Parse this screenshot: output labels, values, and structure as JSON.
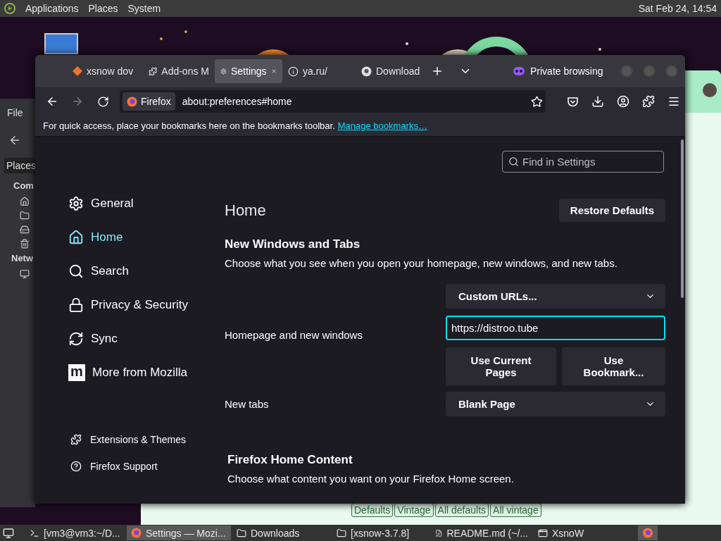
{
  "top_panel": {
    "menus": [
      "Applications",
      "Places",
      "System"
    ],
    "clock": "Sat Feb 24, 14:54"
  },
  "file_manager": {
    "menu": "File",
    "places_button": "Places",
    "sections": [
      "Com",
      "Netw"
    ]
  },
  "xsnow_window": {
    "buttons": [
      "Defaults",
      "Vintage",
      "All defaults",
      "All vintage"
    ]
  },
  "browser": {
    "tabs": [
      {
        "label": "xsnow dov",
        "kind": "xsnow",
        "selected": false
      },
      {
        "label": "Add-ons M",
        "kind": "addons",
        "selected": false
      },
      {
        "label": "Settings",
        "kind": "settings",
        "selected": true
      },
      {
        "label": "ya.ru/",
        "kind": "info",
        "selected": false
      },
      {
        "label": "Download",
        "kind": "download",
        "selected": false
      }
    ],
    "private_label": "Private browsing",
    "identity": "Firefox",
    "address": "about:preferences#home",
    "bookmarks_hint": "For quick access, place your bookmarks here on the bookmarks toolbar.",
    "bookmarks_link": "Manage bookmarks…"
  },
  "settings": {
    "search_placeholder": "Find in Settings",
    "nav": [
      {
        "label": "General",
        "kind": "general",
        "selected": false
      },
      {
        "label": "Home",
        "kind": "home",
        "selected": true
      },
      {
        "label": "Search",
        "kind": "search",
        "selected": false
      },
      {
        "label": "Privacy & Security",
        "kind": "privacy",
        "selected": false
      },
      {
        "label": "Sync",
        "kind": "sync",
        "selected": false
      },
      {
        "label": "More from Mozilla",
        "kind": "mozilla",
        "badge": "m",
        "selected": false
      }
    ],
    "footer_links": [
      {
        "label": "Extensions & Themes",
        "kind": "extensions"
      },
      {
        "label": "Firefox Support",
        "kind": "support"
      }
    ],
    "heading": "Home",
    "restore_button": "Restore Defaults",
    "section_title": "New Windows and Tabs",
    "section_description": "Choose what you see when you open your homepage, new windows, and new tabs.",
    "homepage_label": "Homepage and new windows",
    "homepage_mode": "Custom URLs...",
    "homepage_url": "https://distroo.tube",
    "homepage_buttons": [
      "Use Current Pages",
      "Use Bookmark..."
    ],
    "new_tabs_label": "New tabs",
    "new_tabs_value": "Blank Page",
    "home_content_title": "Firefox Home Content",
    "home_content_description": "Choose what content you want on your Firefox Home screen."
  },
  "taskbar": {
    "items": [
      {
        "label": "[vm3@vm3:~/D...",
        "kind": "terminal",
        "selected": false
      },
      {
        "label": "Settings — Mozi...",
        "kind": "firefox",
        "selected": true
      },
      {
        "label": "Downloads",
        "kind": "folder",
        "selected": false
      },
      {
        "label": "[xsnow-3.7.8]",
        "kind": "folder",
        "selected": false
      },
      {
        "label": "README.md (~/...",
        "kind": "editor",
        "selected": false
      },
      {
        "label": "XsnoW",
        "kind": "window",
        "selected": false
      }
    ]
  }
}
